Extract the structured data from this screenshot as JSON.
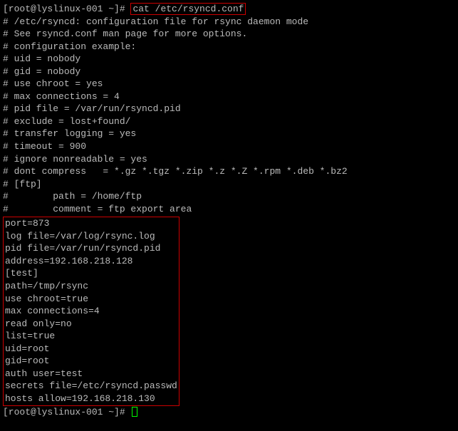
{
  "prompt1": "[root@lyslinux-001 ~]# ",
  "command1": "cat /etc/rsyncd.conf",
  "commentLines": [
    "# /etc/rsyncd: configuration file for rsync daemon mode",
    "",
    "# See rsyncd.conf man page for more options.",
    "",
    "# configuration example:",
    "",
    "# uid = nobody",
    "# gid = nobody",
    "# use chroot = yes",
    "# max connections = 4",
    "# pid file = /var/run/rsyncd.pid",
    "# exclude = lost+found/",
    "# transfer logging = yes",
    "# timeout = 900",
    "# ignore nonreadable = yes",
    "# dont compress   = *.gz *.tgz *.zip *.z *.Z *.rpm *.deb *.bz2",
    "",
    "# [ftp]",
    "#        path = /home/ftp",
    "#        comment = ftp export area"
  ],
  "configLines": [
    "port=873",
    "log file=/var/log/rsync.log",
    "pid file=/var/run/rsyncd.pid",
    "address=192.168.218.128",
    "[test]",
    "path=/tmp/rsync",
    "use chroot=true",
    "max connections=4",
    "read only=no",
    "list=true",
    "uid=root",
    "gid=root",
    "auth user=test",
    "secrets file=/etc/rsyncd.passwd",
    "hosts allow=192.168.218.130"
  ],
  "prompt2": "[root@lyslinux-001 ~]# "
}
